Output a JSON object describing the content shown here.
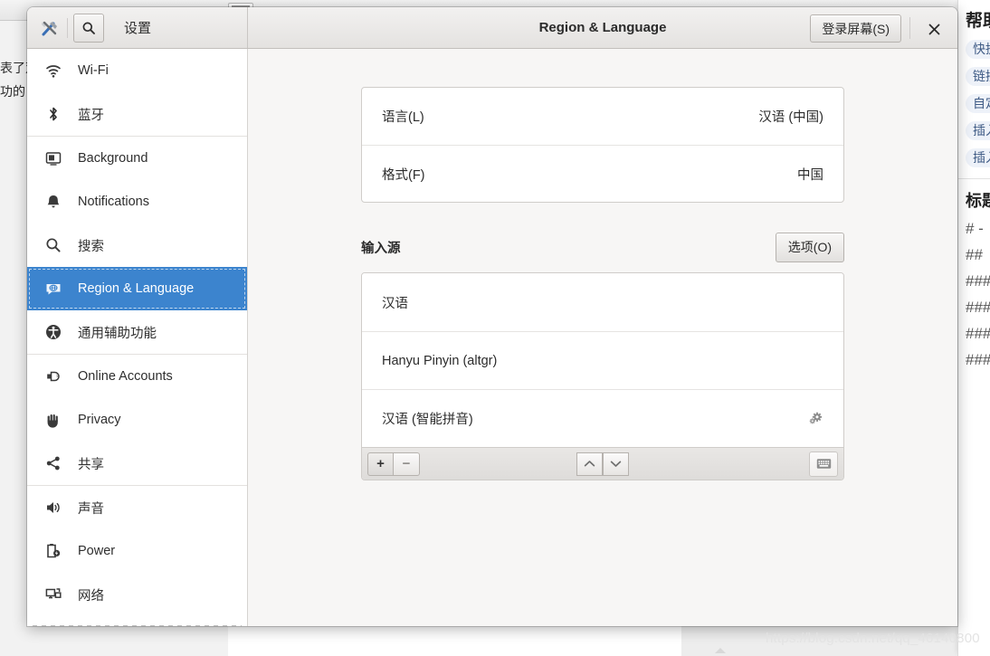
{
  "window": {
    "app_name": "设置",
    "title": "Region & Language",
    "login_screen_button": "登录屏幕(S)",
    "close_label": "✕",
    "accent_color": "#3c84ce",
    "titlebar_bg": "#e9e7e5"
  },
  "sidebar": {
    "items": [
      {
        "label": "Wi-Fi",
        "icon": "wifi-icon",
        "selected": false,
        "separator_after": false
      },
      {
        "label": "蓝牙",
        "icon": "bluetooth-icon",
        "selected": false,
        "separator_after": true
      },
      {
        "label": "Background",
        "icon": "background-icon",
        "selected": false,
        "separator_after": false
      },
      {
        "label": "Notifications",
        "icon": "bell-icon",
        "selected": false,
        "separator_after": false
      },
      {
        "label": "搜索",
        "icon": "search-icon",
        "selected": false,
        "separator_after": false
      },
      {
        "label": "Region & Language",
        "icon": "region-language-icon",
        "selected": true,
        "separator_after": false
      },
      {
        "label": "通用辅助功能",
        "icon": "accessibility-icon",
        "selected": false,
        "separator_after": true
      },
      {
        "label": "Online Accounts",
        "icon": "online-accounts-icon",
        "selected": false,
        "separator_after": false
      },
      {
        "label": "Privacy",
        "icon": "privacy-hand-icon",
        "selected": false,
        "separator_after": false
      },
      {
        "label": "共享",
        "icon": "share-icon",
        "selected": false,
        "separator_after": true
      },
      {
        "label": "声音",
        "icon": "sound-icon",
        "selected": false,
        "separator_after": false
      },
      {
        "label": "Power",
        "icon": "power-battery-icon",
        "selected": false,
        "separator_after": false
      },
      {
        "label": "网络",
        "icon": "network-icon",
        "selected": false,
        "separator_after": false
      }
    ]
  },
  "main": {
    "settings_rows": [
      {
        "label": "语言(L)",
        "value": "汉语 (中国)"
      },
      {
        "label": "格式(F)",
        "value": "中国"
      }
    ],
    "input_sources": {
      "section_title": "输入源",
      "options_button": "选项(O)",
      "items": [
        {
          "label": "汉语",
          "has_gear": false
        },
        {
          "label": "Hanyu Pinyin (altgr)",
          "has_gear": false
        },
        {
          "label": "汉语 (智能拼音)",
          "has_gear": true
        }
      ],
      "toolbar": {
        "add": "+",
        "remove": "−",
        "move_up": "⌃",
        "move_down": "⌄",
        "keyboard": "keyboard-icon"
      }
    }
  },
  "background": {
    "left_text_lines": [
      "表了双",
      "功的"
    ],
    "help_panel": {
      "title": "帮助",
      "chips": [
        "快捷",
        "链接",
        "自定",
        "插入",
        "插入"
      ],
      "sub_title": "标题",
      "heading_rows": [
        "# -",
        "##",
        "###",
        "###",
        "###",
        "###"
      ]
    },
    "watermark": "https://blog.csdn.net/qq_46140800"
  }
}
